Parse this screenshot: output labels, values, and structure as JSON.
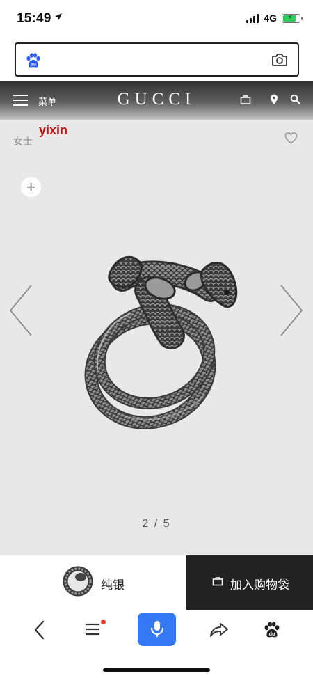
{
  "status_bar": {
    "time": "15:49",
    "network": "4G"
  },
  "search": {
    "placeholder": ""
  },
  "nav": {
    "menu_label": "菜单",
    "brand": "GUCCI"
  },
  "product": {
    "breadcrumb": "女士",
    "watermark": "yixin",
    "page_indicator": "2 / 5"
  },
  "buy_bar": {
    "material_label": "纯银",
    "add_to_bag_label": "加入购物袋"
  },
  "colors": {
    "accent_blue": "#3478f6",
    "buy_button_bg": "#222222",
    "watermark_red": "#c01010"
  },
  "icons": [
    "location-arrow-icon",
    "baidu-logo",
    "camera-icon",
    "menu-icon",
    "shopping-bag-icon",
    "location-pin-icon",
    "search-icon",
    "heart-icon",
    "plus-icon",
    "chevron-left-icon",
    "chevron-right-icon",
    "back-icon",
    "list-icon",
    "microphone-icon",
    "share-icon",
    "baidu-paw-icon"
  ]
}
